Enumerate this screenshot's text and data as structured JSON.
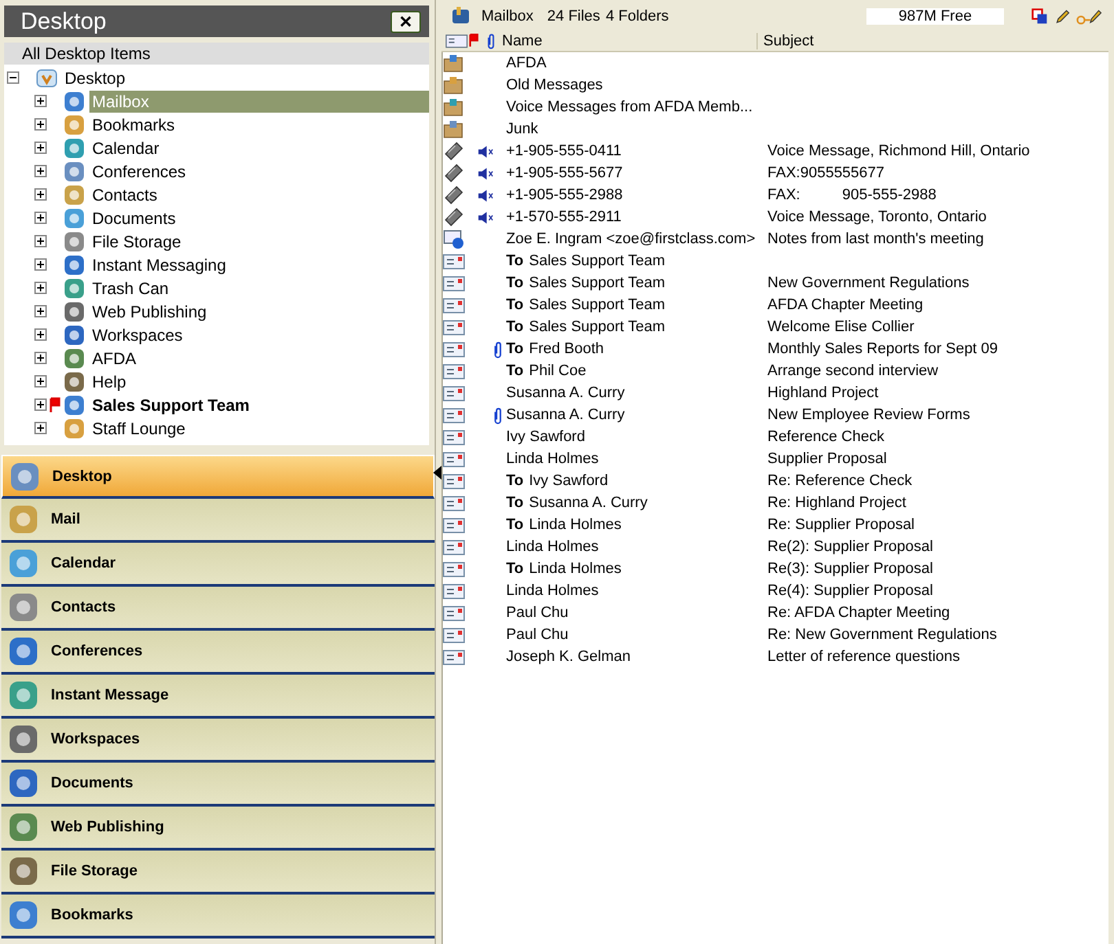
{
  "left_panel": {
    "title": "Desktop",
    "close_label": "✕",
    "filter": "All Desktop Items",
    "tree": [
      {
        "label": "Desktop",
        "expanded": true,
        "selected": false,
        "bold": false,
        "flagged": false,
        "children": [
          {
            "label": "Mailbox",
            "expanded": false,
            "selected": true,
            "bold": false,
            "flagged": false
          },
          {
            "label": "Bookmarks",
            "expanded": false,
            "selected": false,
            "bold": false,
            "flagged": false
          },
          {
            "label": "Calendar",
            "expanded": false,
            "selected": false,
            "bold": false,
            "flagged": false
          },
          {
            "label": "Conferences",
            "expanded": false,
            "selected": false,
            "bold": false,
            "flagged": false
          },
          {
            "label": "Contacts",
            "expanded": false,
            "selected": false,
            "bold": false,
            "flagged": false
          },
          {
            "label": "Documents",
            "expanded": false,
            "selected": false,
            "bold": false,
            "flagged": false
          },
          {
            "label": "File Storage",
            "expanded": false,
            "selected": false,
            "bold": false,
            "flagged": false
          },
          {
            "label": "Instant Messaging",
            "expanded": false,
            "selected": false,
            "bold": false,
            "flagged": false
          },
          {
            "label": "Trash Can",
            "expanded": false,
            "selected": false,
            "bold": false,
            "flagged": false
          },
          {
            "label": "Web Publishing",
            "expanded": false,
            "selected": false,
            "bold": false,
            "flagged": false
          },
          {
            "label": "Workspaces",
            "expanded": false,
            "selected": false,
            "bold": false,
            "flagged": false
          },
          {
            "label": "AFDA",
            "expanded": false,
            "selected": false,
            "bold": false,
            "flagged": false
          },
          {
            "label": "Help",
            "expanded": false,
            "selected": false,
            "bold": false,
            "flagged": false
          },
          {
            "label": "Sales Support Team",
            "expanded": false,
            "selected": false,
            "bold": true,
            "flagged": true
          },
          {
            "label": "Staff Lounge",
            "expanded": false,
            "selected": false,
            "bold": false,
            "flagged": false
          }
        ]
      }
    ],
    "nav": [
      {
        "label": "Desktop",
        "selected": true
      },
      {
        "label": "Mail",
        "selected": false
      },
      {
        "label": "Calendar",
        "selected": false
      },
      {
        "label": "Contacts",
        "selected": false
      },
      {
        "label": "Conferences",
        "selected": false
      },
      {
        "label": "Instant Message",
        "selected": false
      },
      {
        "label": "Workspaces",
        "selected": false
      },
      {
        "label": "Documents",
        "selected": false
      },
      {
        "label": "Web Publishing",
        "selected": false
      },
      {
        "label": "File Storage",
        "selected": false
      },
      {
        "label": "Bookmarks",
        "selected": false
      }
    ]
  },
  "mailbox": {
    "title": "Mailbox",
    "files": "24 Files",
    "folders": "4 Folders",
    "free": "987M Free",
    "columns": [
      "Name",
      "Subject"
    ],
    "rows": [
      {
        "kind": "folder",
        "voice": false,
        "attachment": false,
        "name": "AFDA"
      },
      {
        "kind": "folder",
        "voice": false,
        "attachment": false,
        "name": "Old Messages"
      },
      {
        "kind": "folder",
        "voice": false,
        "attachment": false,
        "name": "Voice Messages from AFDA Memb..."
      },
      {
        "kind": "folder",
        "voice": false,
        "attachment": false,
        "name": "Junk"
      },
      {
        "kind": "phone",
        "voice": true,
        "attachment": false,
        "name": "+1-905-555-0411",
        "subject": "Voice Message, Richmond Hill, Ontario"
      },
      {
        "kind": "phone",
        "voice": true,
        "attachment": false,
        "name": "+1-905-555-5677",
        "subject": "FAX:9055555677"
      },
      {
        "kind": "phone",
        "voice": true,
        "attachment": false,
        "name": "+1-905-555-2988",
        "subject": "FAX:          905-555-2988"
      },
      {
        "kind": "phone",
        "voice": true,
        "attachment": false,
        "name": "+1-570-555-2911",
        "subject": "Voice Message, Toronto, Ontario"
      },
      {
        "kind": "contact",
        "voice": false,
        "attachment": false,
        "name": "Zoe E. Ingram <zoe@firstclass.com>",
        "subject": "Notes from last month's meeting"
      },
      {
        "kind": "message",
        "voice": false,
        "attachment": false,
        "prefix": "To",
        "name": "Sales Support Team"
      },
      {
        "kind": "message",
        "voice": false,
        "attachment": false,
        "prefix": "To",
        "name": "Sales Support Team",
        "subject": "New Government Regulations"
      },
      {
        "kind": "message",
        "voice": false,
        "attachment": false,
        "prefix": "To",
        "name": "Sales Support Team",
        "subject": "AFDA Chapter Meeting"
      },
      {
        "kind": "message",
        "voice": false,
        "attachment": false,
        "prefix": "To",
        "name": "Sales Support Team",
        "subject": "Welcome Elise Collier"
      },
      {
        "kind": "message",
        "voice": false,
        "attachment": true,
        "prefix": "To",
        "name": "Fred Booth",
        "subject": "Monthly Sales Reports for Sept 09"
      },
      {
        "kind": "message",
        "voice": false,
        "attachment": false,
        "prefix": "To",
        "name": "Phil Coe",
        "subject": "Arrange second interview"
      },
      {
        "kind": "message",
        "voice": false,
        "attachment": false,
        "name": "Susanna A. Curry",
        "subject": "Highland Project"
      },
      {
        "kind": "message",
        "voice": false,
        "attachment": true,
        "name": "Susanna A. Curry",
        "subject": "New Employee Review Forms"
      },
      {
        "kind": "message",
        "voice": false,
        "attachment": false,
        "name": "Ivy Sawford",
        "subject": "Reference Check"
      },
      {
        "kind": "message",
        "voice": false,
        "attachment": false,
        "name": "Linda Holmes",
        "subject": "Supplier Proposal"
      },
      {
        "kind": "message",
        "voice": false,
        "attachment": false,
        "prefix": "To",
        "name": "Ivy Sawford",
        "subject": "Re: Reference Check"
      },
      {
        "kind": "message",
        "voice": false,
        "attachment": false,
        "prefix": "To",
        "name": "Susanna A. Curry",
        "subject": "Re: Highland Project"
      },
      {
        "kind": "message",
        "voice": false,
        "attachment": false,
        "prefix": "To",
        "name": "Linda Holmes",
        "subject": "Re: Supplier Proposal"
      },
      {
        "kind": "message",
        "voice": false,
        "attachment": false,
        "name": "Linda Holmes",
        "subject": "Re(2): Supplier Proposal"
      },
      {
        "kind": "message",
        "voice": false,
        "attachment": false,
        "prefix": "To",
        "name": "Linda Holmes",
        "subject": "Re(3): Supplier Proposal"
      },
      {
        "kind": "message",
        "voice": false,
        "attachment": false,
        "name": "Linda Holmes",
        "subject": "Re(4): Supplier Proposal"
      },
      {
        "kind": "message",
        "voice": false,
        "attachment": false,
        "name": "Paul Chu",
        "subject": "Re: AFDA Chapter Meeting"
      },
      {
        "kind": "message",
        "voice": false,
        "attachment": false,
        "name": "Paul Chu",
        "subject": "Re: New Government Regulations"
      },
      {
        "kind": "message",
        "voice": false,
        "attachment": false,
        "name": "Joseph K. Gelman",
        "subject": "Letter of reference questions"
      }
    ]
  }
}
